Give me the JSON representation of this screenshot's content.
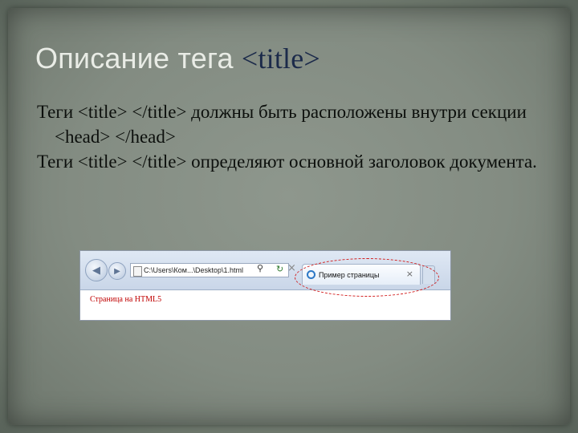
{
  "slide": {
    "title_main": "Описание тега ",
    "title_tag": "<title>",
    "bullets": [
      "Теги <title> </title> должны быть расположены внутри секции <head> </head>",
      "Теги <title> </title> определяют основной заголовок документа."
    ]
  },
  "browser": {
    "address": "C:\\Users\\Ком...\\Desktop\\1.html",
    "tab_title": "Пример страницы",
    "page_text": "Страница на HTML5",
    "icons": {
      "back": "back-arrow-icon",
      "forward": "forward-arrow-icon",
      "page": "page-icon",
      "search": "search-icon",
      "refresh": "refresh-icon",
      "stop": "stop-icon",
      "tab_favicon": "ie-icon",
      "close": "close-icon"
    },
    "colors": {
      "annotation_circle": "#d21a1a",
      "page_text": "#c00000"
    }
  }
}
